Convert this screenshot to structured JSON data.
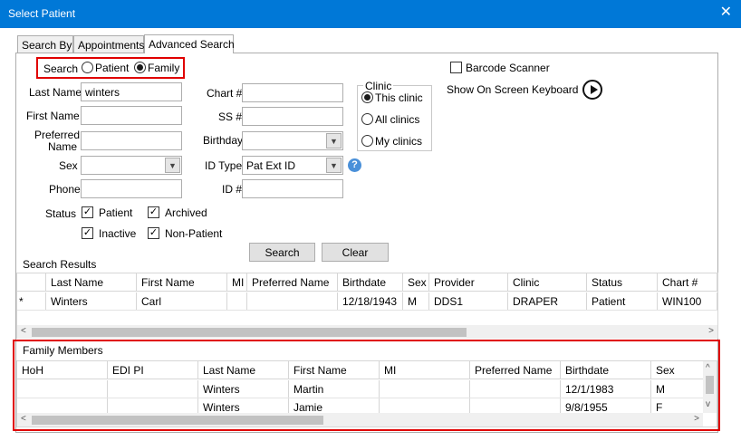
{
  "window": {
    "title": "Select Patient",
    "close_glyph": "✕"
  },
  "tabs": [
    {
      "label": "Search By"
    },
    {
      "label": "Appointments"
    },
    {
      "label": "Advanced Search"
    }
  ],
  "search": {
    "label": "Search",
    "options": [
      "Patient",
      "Family"
    ],
    "selected": "Family"
  },
  "form": {
    "last_name_label": "Last Name",
    "last_name_value": "winters",
    "first_name_label": "First Name",
    "preferred_name_label_1": "Preferred",
    "preferred_name_label_2": "Name",
    "sex_label": "Sex",
    "phone_label": "Phone",
    "chart_label": "Chart #",
    "ss_label": "SS #",
    "birthday_label": "Birthday",
    "id_type_label": "ID Type",
    "id_type_value": "Pat Ext ID",
    "id_label": "ID #",
    "status_label": "Status"
  },
  "clinic": {
    "legend": "Clinic",
    "options": [
      "This clinic",
      "All clinics",
      "My clinics"
    ],
    "selected": "This clinic"
  },
  "status_checks": [
    {
      "label": "Patient",
      "checked": true
    },
    {
      "label": "Archived",
      "checked": true
    },
    {
      "label": "Inactive",
      "checked": true
    },
    {
      "label": "Non-Patient",
      "checked": true
    }
  ],
  "barcode": {
    "label": "Barcode Scanner",
    "checked": false
  },
  "keyboard": {
    "label": "Show On Screen Keyboard"
  },
  "buttons": {
    "search": "Search",
    "clear": "Clear"
  },
  "results": {
    "title": "Search Results",
    "columns": [
      "Last Name",
      "First Name",
      "MI",
      "Preferred Name",
      "Birthdate",
      "Sex",
      "Provider",
      "Clinic",
      "Status",
      "Chart #"
    ],
    "rows": [
      {
        "marker": "*",
        "cells": [
          "Winters",
          "Carl",
          "",
          "",
          "12/18/1943",
          "M",
          "DDS1",
          "DRAPER",
          "Patient",
          "WIN100"
        ]
      }
    ]
  },
  "family": {
    "title": "Family Members",
    "columns": [
      "HoH",
      "EDI PI",
      "Last Name",
      "First Name",
      "MI",
      "Preferred Name",
      "Birthdate",
      "Sex"
    ],
    "rows": [
      [
        "",
        "",
        "Winters",
        "Martin",
        "",
        "",
        "12/1/1983",
        "M"
      ],
      [
        "",
        "",
        "Winters",
        "Jamie",
        "",
        "",
        "9/8/1955",
        "F"
      ]
    ]
  },
  "colors": {
    "accent": "#0078d7",
    "highlight": "#e00000"
  }
}
